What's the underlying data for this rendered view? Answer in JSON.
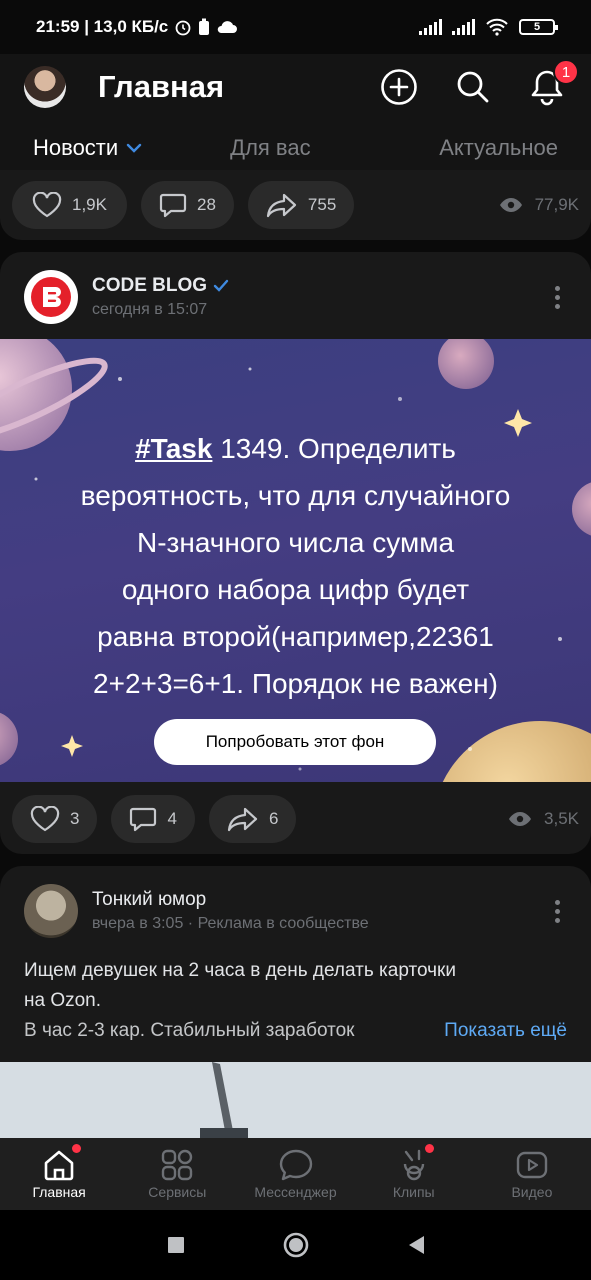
{
  "status_bar": {
    "time_speed": "21:59 | 13,0 КБ/с",
    "battery": "5"
  },
  "header": {
    "title": "Главная",
    "notification_count": "1",
    "icons": [
      "add-icon",
      "search-icon",
      "bell-icon"
    ]
  },
  "tabs": [
    {
      "label": "Новости"
    },
    {
      "label": "Для вас"
    },
    {
      "label": "Актуальное"
    }
  ],
  "post1": {
    "likes": "1,9K",
    "comments": "28",
    "shares": "755",
    "views": "77,9K"
  },
  "post2": {
    "author": "CODE BLOG",
    "time": "сегодня в 15:07",
    "art": {
      "tag": "#Task",
      "text_line1_rest": " 1349. Определить",
      "text_line2": "вероятность, что для случайного",
      "text_line3": "N-значного числа сумма",
      "text_line4": "одного набора цифр будет",
      "text_line5": "равна второй(например,22361",
      "text_line6": "2+2+3=6+1. Порядок не важен)",
      "button": "Попробовать этот фон"
    },
    "likes": "3",
    "comments": "4",
    "shares": "6",
    "views": "3,5K"
  },
  "post3": {
    "author": "Тонкий юмор",
    "meta": "вчера в 3:05 · Реклама в сообществе",
    "line1": "Ищем девушек на 2 часа в день делать карточки",
    "line2": "на Ozon.",
    "line3": "В час 2-3 кар. Стабильный заработок",
    "show_more": "Показать ещё"
  },
  "tabbar": [
    {
      "label": "Главная",
      "icon": "home-icon"
    },
    {
      "label": "Сервисы",
      "icon": "services-icon"
    },
    {
      "label": "Мессенджер",
      "icon": "messenger-icon"
    },
    {
      "label": "Клипы",
      "icon": "clips-icon"
    },
    {
      "label": "Видео",
      "icon": "video-icon"
    }
  ],
  "colors": {
    "accent": "#3f8ae0",
    "badge": "#ff3347",
    "link": "#5eaaf5",
    "background": "#0a0a0a",
    "card": "#191919"
  }
}
